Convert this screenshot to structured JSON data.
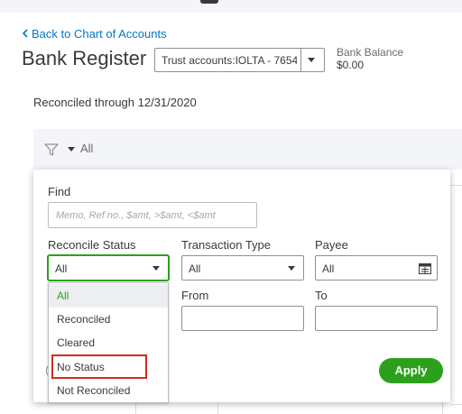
{
  "header": {
    "back_link": "Back to Chart of Accounts",
    "title": "Bank Register",
    "account_select_value": "Trust accounts:IOLTA - 7654",
    "bank_balance_label": "Bank Balance",
    "bank_balance_value": "$0.00"
  },
  "reconciled_through": "Reconciled through 12/31/2020",
  "filter_bar": {
    "all_label": "All"
  },
  "filter_panel": {
    "find_label": "Find",
    "find_placeholder": "Memo, Ref no., $amt, >$amt, <$amt",
    "reconcile_status": {
      "label": "Reconcile Status",
      "value": "All",
      "options": [
        "All",
        "Reconciled",
        "Cleared",
        "No Status",
        "Not Reconciled"
      ],
      "highlighted_option": "No Status"
    },
    "transaction_type": {
      "label": "Transaction Type",
      "value": "All"
    },
    "payee": {
      "label": "Payee",
      "value": "All"
    },
    "from_label": "From",
    "to_label": "To",
    "apply_label": "Apply"
  },
  "colors": {
    "accent_green": "#2ca01c",
    "link_blue": "#0077c5",
    "highlight_red": "#d52b1e"
  },
  "icons": [
    "chevron-left-icon",
    "chevron-down-icon",
    "filter-funnel-icon",
    "list-picker-icon"
  ]
}
